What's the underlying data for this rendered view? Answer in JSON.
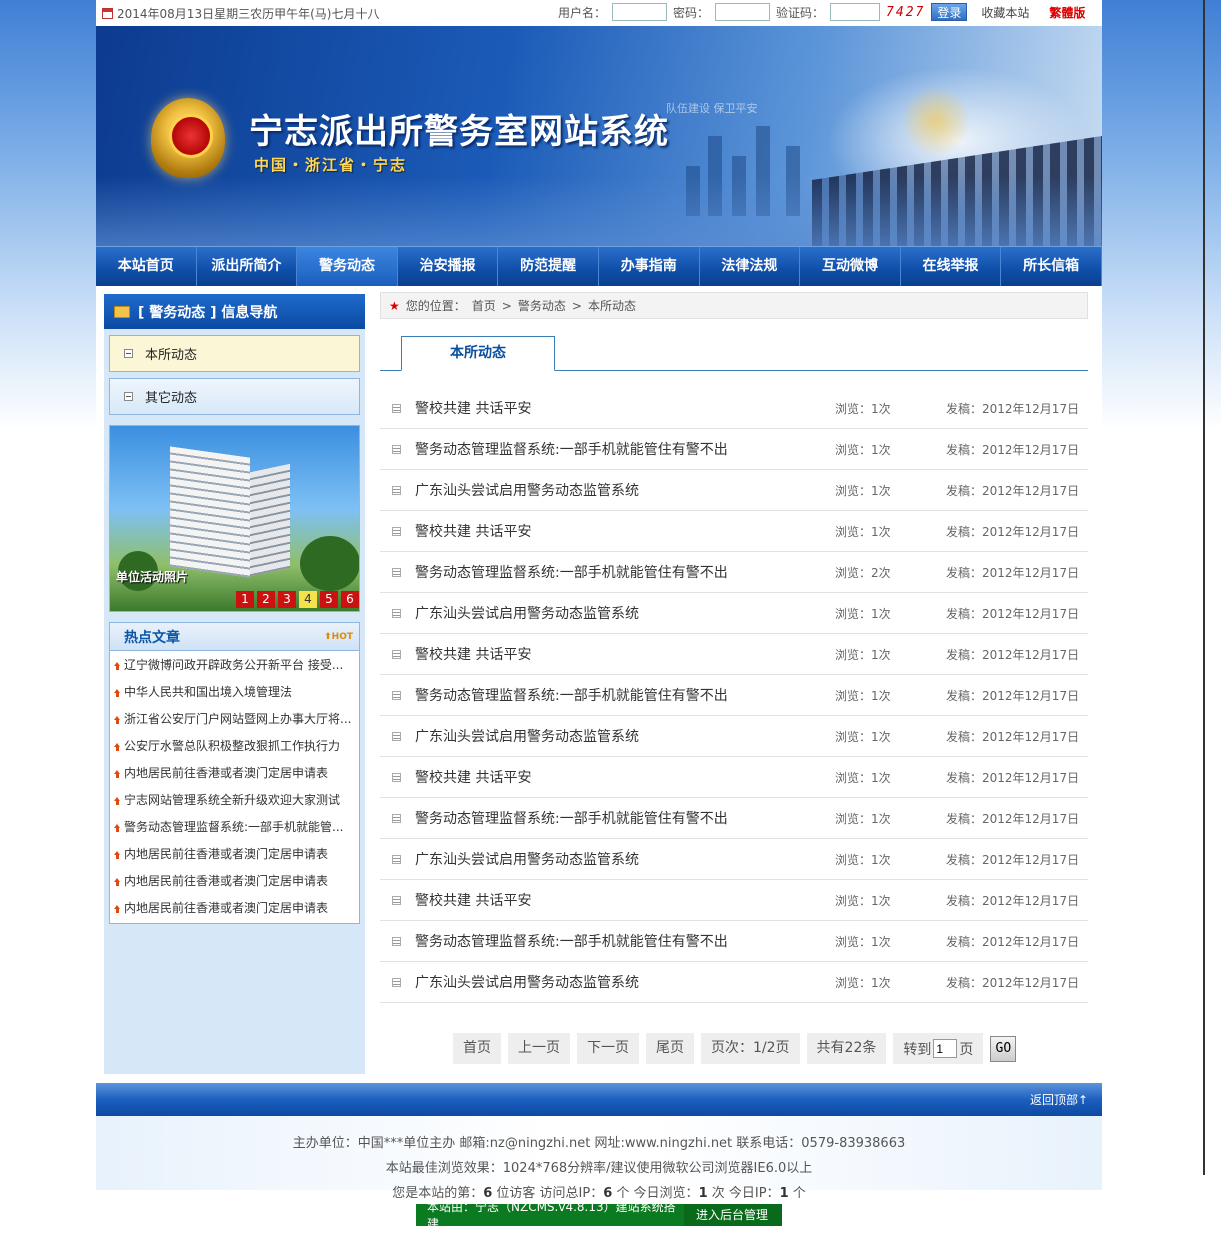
{
  "topbar": {
    "date_text": "2014年08月13日星期三农历甲午年(马)七月十八",
    "username_label": "用户名：",
    "password_label": "密码：",
    "captcha_label": "验证码：",
    "captcha_code": "7427",
    "login_button": "登录",
    "favorite": "收藏本站",
    "traditional": "繁體版"
  },
  "banner": {
    "title": "宁志派出所警务室网站系统",
    "subtitle": "中国・浙江省・宁志",
    "slogan": "队伍建设 保卫平安"
  },
  "nav": [
    "本站首页",
    "派出所简介",
    "警务动态",
    "治安播报",
    "防范提醒",
    "办事指南",
    "法律法规",
    "互动微博",
    "在线举报",
    "所长信箱"
  ],
  "nav_active_index": 2,
  "sidebar": {
    "header": "[ 警务动态 ] 信息导航",
    "items": [
      "本所动态",
      "其它动态"
    ],
    "photo_caption": "单位活动照片",
    "photo_pages": [
      "1",
      "2",
      "3",
      "4",
      "5",
      "6"
    ],
    "photo_active_page": "4",
    "hot_title": "热点文章",
    "hot_tag": "HOT",
    "hot_articles": [
      "辽宁微博问政开辟政务公开新平台 接受...",
      "中华人民共和国出境入境管理法",
      "浙江省公安厅门户网站暨网上办事大厅将...",
      "公安厅水警总队积极整改狠抓工作执行力",
      "内地居民前往香港或者澳门定居申请表",
      "宁志网站管理系统全新升级欢迎大家测试",
      "警务动态管理监督系统:一部手机就能管...",
      "内地居民前往香港或者澳门定居申请表",
      "内地居民前往香港或者澳门定居申请表",
      "内地居民前往香港或者澳门定居申请表"
    ]
  },
  "breadcrumb": {
    "prefix": "您的位置：",
    "items": [
      "首页",
      "警务动态",
      "本所动态"
    ]
  },
  "tab_label": "本所动态",
  "news": [
    {
      "title": "警校共建 共话平安",
      "views": "浏览：1次",
      "date": "发稿：2012年12月17日"
    },
    {
      "title": "警务动态管理监督系统:一部手机就能管住有警不出",
      "views": "浏览：1次",
      "date": "发稿：2012年12月17日"
    },
    {
      "title": "广东汕头尝试启用警务动态监管系统",
      "views": "浏览：1次",
      "date": "发稿：2012年12月17日"
    },
    {
      "title": "警校共建 共话平安",
      "views": "浏览：1次",
      "date": "发稿：2012年12月17日"
    },
    {
      "title": "警务动态管理监督系统:一部手机就能管住有警不出",
      "views": "浏览：2次",
      "date": "发稿：2012年12月17日"
    },
    {
      "title": "广东汕头尝试启用警务动态监管系统",
      "views": "浏览：1次",
      "date": "发稿：2012年12月17日"
    },
    {
      "title": "警校共建 共话平安",
      "views": "浏览：1次",
      "date": "发稿：2012年12月17日"
    },
    {
      "title": "警务动态管理监督系统:一部手机就能管住有警不出",
      "views": "浏览：1次",
      "date": "发稿：2012年12月17日"
    },
    {
      "title": "广东汕头尝试启用警务动态监管系统",
      "views": "浏览：1次",
      "date": "发稿：2012年12月17日"
    },
    {
      "title": "警校共建 共话平安",
      "views": "浏览：1次",
      "date": "发稿：2012年12月17日"
    },
    {
      "title": "警务动态管理监督系统:一部手机就能管住有警不出",
      "views": "浏览：1次",
      "date": "发稿：2012年12月17日"
    },
    {
      "title": "广东汕头尝试启用警务动态监管系统",
      "views": "浏览：1次",
      "date": "发稿：2012年12月17日"
    },
    {
      "title": "警校共建 共话平安",
      "views": "浏览：1次",
      "date": "发稿：2012年12月17日"
    },
    {
      "title": "警务动态管理监督系统:一部手机就能管住有警不出",
      "views": "浏览：1次",
      "date": "发稿：2012年12月17日"
    },
    {
      "title": "广东汕头尝试启用警务动态监管系统",
      "views": "浏览：1次",
      "date": "发稿：2012年12月17日"
    }
  ],
  "pager": {
    "first": "首页",
    "prev": "上一页",
    "next": "下一页",
    "last": "尾页",
    "page_info": "页次：1/2页",
    "total": "共有22条",
    "goto_label": "转到",
    "goto_value": "1",
    "goto_suffix": "页",
    "go": "GO"
  },
  "footer": {
    "back_top": "返回顶部↑",
    "line1": "主办单位：中国***单位主办  邮箱:nz@ningzhi.net  网址:www.ningzhi.net  联系电话：0579-83938663",
    "line2": "本站最佳浏览效果：1024*768分辨率/建议使用微软公司浏览器IE6.0以上",
    "visitor_prefix": "您是本站的第：",
    "visitor_count": "6",
    "visitor_suffix": "位访客  访问总IP：",
    "total_ip": "6",
    "today_views_label": "个  今日浏览：",
    "today_views": "1",
    "today_ip_label": "次  今日IP：",
    "today_ip": "1",
    "ip_unit": "个",
    "powered": "本站由：宁志（NZCMS.v4.8.13）建站系统搭建",
    "admin": "进入后台管理"
  }
}
